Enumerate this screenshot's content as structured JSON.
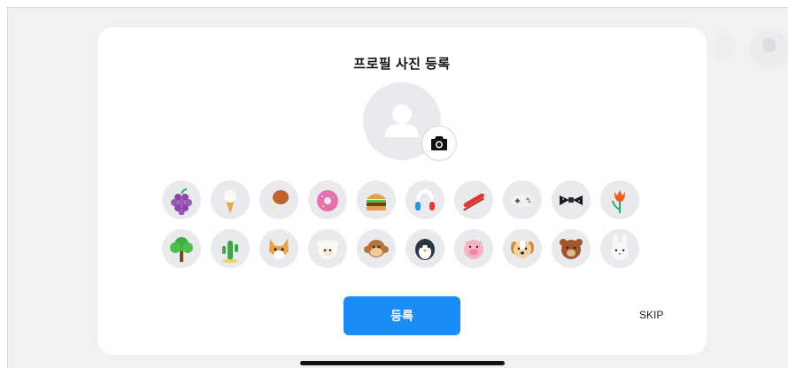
{
  "modal": {
    "title": "프로필 사진 등록",
    "register_label": "등록",
    "skip_label": "SKIP"
  },
  "profile": {
    "placeholder_icon": "person-icon",
    "camera_icon": "camera-icon"
  },
  "avatars": {
    "row1": [
      "grape",
      "ice-cream",
      "chicken-drumstick",
      "donut",
      "hamburger",
      "headphones",
      "skateboard",
      "game-controller",
      "bow-tie",
      "tulip"
    ],
    "row2": [
      "tree",
      "cactus",
      "fox",
      "sheep",
      "monkey",
      "penguin",
      "pig",
      "dog",
      "bear",
      "rabbit"
    ]
  },
  "colors": {
    "accent": "#1a8cf5",
    "circle_bg": "#e9eaee"
  }
}
